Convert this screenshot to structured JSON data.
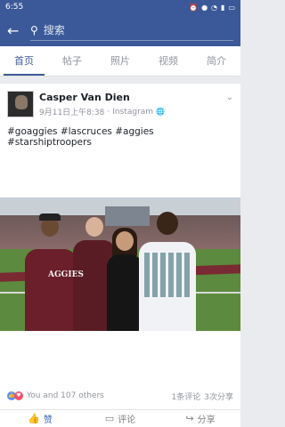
{
  "status_bar": {
    "time": "6:55",
    "icons": [
      "alarm-icon",
      "notification-icon",
      "wifi-icon",
      "signal-icon",
      "battery-icon"
    ]
  },
  "app_bar": {
    "back_icon": "arrow-left-icon",
    "search_placeholder": "搜索"
  },
  "tabs": [
    {
      "label": "首页",
      "active": true
    },
    {
      "label": "帖子",
      "active": false
    },
    {
      "label": "照片",
      "active": false
    },
    {
      "label": "视频",
      "active": false
    },
    {
      "label": "简介",
      "active": false
    }
  ],
  "post": {
    "author": "Casper Van Dien",
    "timestamp": "9月11日上午8:38",
    "source": "Instagram",
    "separator": "·",
    "text": "#goaggies #lascruces #aggies #starshiptroopers",
    "photo_text": "AGGIES",
    "likes_text": "You and 107 others",
    "comments": "1条评论",
    "shares": "3次分享"
  },
  "actions": {
    "like": "赞",
    "comment": "评论",
    "share": "分享"
  },
  "colors": {
    "brand": "#3b5998",
    "like_blue": "#5890ff",
    "love_red": "#f25268"
  }
}
